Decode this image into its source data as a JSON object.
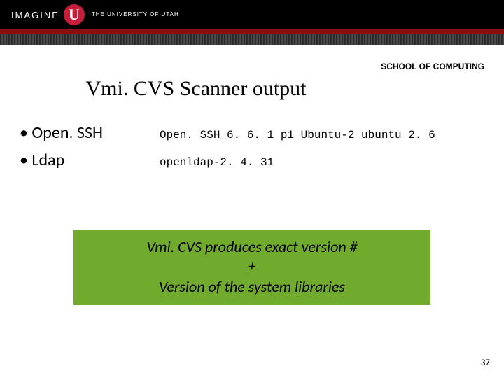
{
  "header": {
    "imagine": "IMAGINE",
    "u_logo": "U",
    "university_line1": "THE UNIVERSITY OF UTAH"
  },
  "school_label": "SCHOOL OF COMPUTING",
  "title": "Vmi. CVS Scanner output",
  "bullets": [
    {
      "label": "Open. SSH",
      "value": "Open. SSH_6. 6. 1 p1 Ubuntu-2 ubuntu 2. 6"
    },
    {
      "label": "Ldap",
      "value": "openldap-2. 4. 31"
    }
  ],
  "callout": {
    "line1": "Vmi. CVS produces exact version #",
    "plus": "+",
    "line3": "Version of  the system libraries"
  },
  "page_number": "37"
}
